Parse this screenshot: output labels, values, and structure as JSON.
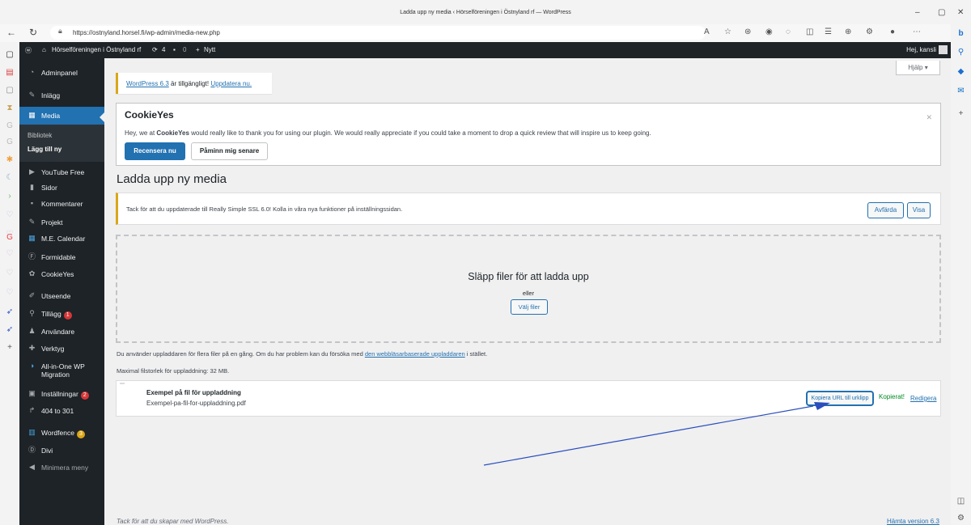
{
  "browser": {
    "title": "Ladda upp ny media ‹ Hörselföreningen i Östnyland rf — WordPress",
    "url": "https://ostnyland.horsel.fi/wp-admin/media-new.php"
  },
  "adminbar": {
    "site": "Hörselföreningen i Östnyland rf",
    "updates": "4",
    "comments": "0",
    "new": "Nytt",
    "greeting": "Hej, kansli"
  },
  "menu": {
    "dashboard": "Adminpanel",
    "posts": "Inlägg",
    "media": "Media",
    "media_library": "Bibliotek",
    "media_add": "Lägg till ny",
    "youtube": "YouTube Free",
    "pages": "Sidor",
    "comments": "Kommentarer",
    "projects": "Projekt",
    "calendar": "M.E. Calendar",
    "formidable": "Formidable",
    "cookieyes": "CookieYes",
    "appearance": "Utseende",
    "plugins": "Tillägg",
    "plugins_badge": "1",
    "users": "Användare",
    "tools": "Verktyg",
    "migration": "All-in-One WP",
    "migration2": "Migration",
    "settings": "Inställningar",
    "settings_badge": "2",
    "redirect": "404 to 301",
    "wordfence": "Wordfence",
    "wordfence_badge": "3",
    "divi": "Divi",
    "collapse": "Minimera meny"
  },
  "help": "Hjälp ▾",
  "update_notice": {
    "version_link": "WordPress 6.3",
    "mid": " är tillgängligt! ",
    "update_link": "Uppdatera nu."
  },
  "cookieyes": {
    "logo": "CookieYes",
    "msg_pre": "Hey, we at ",
    "msg_brand": "CookieYes",
    "msg_post": " would really like to thank you for using our plugin. We would really appreciate if you could take a moment to drop a quick review that will inspire us to keep going.",
    "review_btn": "Recensera nu",
    "later_btn": "Påminn mig senare"
  },
  "page_title": "Ladda upp ny media",
  "ssl_notice": {
    "text": "Tack för att du uppdaterade till Really Simple SSL 6.0! Kolla in våra nya funktioner på inställningssidan.",
    "dismiss": "Avfärda",
    "show": "Visa"
  },
  "dropzone": {
    "heading": "Släpp filer för att ladda upp",
    "or": "eller",
    "choose": "Välj filer"
  },
  "info": {
    "uploader_pre": "Du använder uppladdaren för flera filer på en gång. Om du har problem kan du försöka med ",
    "uploader_link": "den webbläsarbaserade uppladdaren",
    "uploader_post": " i stället.",
    "max_size": "Maximal filstorlek för uppladdning: 32 MB."
  },
  "file": {
    "title": "Exempel på fil för uppladdning",
    "filename": "Exempel-pa-fil-for-uppladdning.pdf",
    "copy_url": "Kopiera URL till urklipp",
    "copied": "Kopierat!",
    "edit": "Redigera"
  },
  "footer": {
    "thanks": "Tack för att du skapar med WordPress.",
    "version": "Hämta version 6.3"
  },
  "colors": {
    "admin_dark": "#1d2327",
    "accent": "#2271b1",
    "warning": "#dba617",
    "success": "#008a20",
    "annotation_arrow": "#2a4ebd"
  }
}
